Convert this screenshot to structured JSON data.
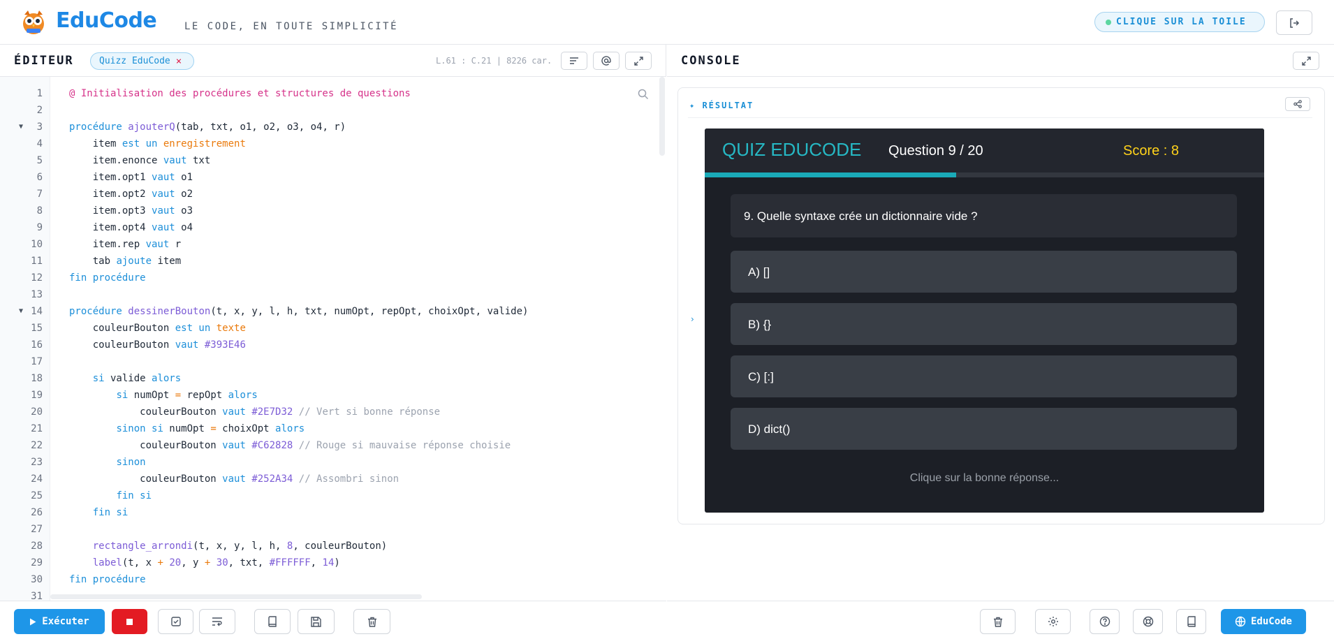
{
  "header": {
    "brand": "EduCode",
    "tagline": "LE CODE, EN TOUTE SIMPLICITÉ",
    "hint": "CLIQUE SUR LA TOILE"
  },
  "editor": {
    "title": "ÉDITEUR",
    "file_tab": "Quizz EduCode",
    "cursor_info": "L.61 : C.21 | 8226 car.",
    "lines": [
      {
        "n": "1",
        "fold": "",
        "html": "<span class=\"dr\">@ Initialisation des procédures et structures de questions</span>"
      },
      {
        "n": "2",
        "fold": "",
        "html": ""
      },
      {
        "n": "3",
        "fold": "▼",
        "html": "<span class=\"kw\">procédure</span> <span class=\"fn\">ajouterQ</span>(tab, txt, o1, o2, o3, o4, r)"
      },
      {
        "n": "4",
        "fold": "",
        "html": "    item <span class=\"kw\">est un</span> <span class=\"ty\">enregistrement</span>"
      },
      {
        "n": "5",
        "fold": "",
        "html": "    item.enonce <span class=\"kw\">vaut</span> txt"
      },
      {
        "n": "6",
        "fold": "",
        "html": "    item.opt1 <span class=\"kw\">vaut</span> o1"
      },
      {
        "n": "7",
        "fold": "",
        "html": "    item.opt2 <span class=\"kw\">vaut</span> o2"
      },
      {
        "n": "8",
        "fold": "",
        "html": "    item.opt3 <span class=\"kw\">vaut</span> o3"
      },
      {
        "n": "9",
        "fold": "",
        "html": "    item.opt4 <span class=\"kw\">vaut</span> o4"
      },
      {
        "n": "10",
        "fold": "",
        "html": "    item.rep <span class=\"kw\">vaut</span> r"
      },
      {
        "n": "11",
        "fold": "",
        "html": "    tab <span class=\"kw\">ajoute</span> item"
      },
      {
        "n": "12",
        "fold": "",
        "html": "<span class=\"kw\">fin procédure</span>"
      },
      {
        "n": "13",
        "fold": "",
        "html": ""
      },
      {
        "n": "14",
        "fold": "▼",
        "html": "<span class=\"kw\">procédure</span> <span class=\"fn\">dessinerBouton</span>(t, x, y, l, h, txt, numOpt, repOpt, choixOpt, valide)"
      },
      {
        "n": "15",
        "fold": "",
        "html": "    couleurBouton <span class=\"kw\">est un</span> <span class=\"ty\">texte</span>"
      },
      {
        "n": "16",
        "fold": "",
        "html": "    couleurBouton <span class=\"kw\">vaut</span> <span class=\"num\">#393E46</span>"
      },
      {
        "n": "17",
        "fold": "",
        "html": ""
      },
      {
        "n": "18",
        "fold": "",
        "html": "    <span class=\"kw\">si</span> valide <span class=\"kw\">alors</span>"
      },
      {
        "n": "19",
        "fold": "",
        "html": "        <span class=\"kw\">si</span> numOpt <span class=\"op\">=</span> repOpt <span class=\"kw\">alors</span>"
      },
      {
        "n": "20",
        "fold": "",
        "html": "            couleurBouton <span class=\"kw\">vaut</span> <span class=\"num\">#2E7D32</span> <span class=\"cm\">// Vert si bonne réponse</span>"
      },
      {
        "n": "21",
        "fold": "",
        "html": "        <span class=\"kw\">sinon si</span> numOpt <span class=\"op\">=</span> choixOpt <span class=\"kw\">alors</span>"
      },
      {
        "n": "22",
        "fold": "",
        "html": "            couleurBouton <span class=\"kw\">vaut</span> <span class=\"num\">#C62828</span> <span class=\"cm\">// Rouge si mauvaise réponse choisie</span>"
      },
      {
        "n": "23",
        "fold": "",
        "html": "        <span class=\"kw\">sinon</span>"
      },
      {
        "n": "24",
        "fold": "",
        "html": "            couleurBouton <span class=\"kw\">vaut</span> <span class=\"num\">#252A34</span> <span class=\"cm\">// Assombri sinon</span>"
      },
      {
        "n": "25",
        "fold": "",
        "html": "        <span class=\"kw\">fin si</span>"
      },
      {
        "n": "26",
        "fold": "",
        "html": "    <span class=\"kw\">fin si</span>"
      },
      {
        "n": "27",
        "fold": "",
        "html": ""
      },
      {
        "n": "28",
        "fold": "",
        "html": "    <span class=\"fn\">rectangle_arrondi</span>(t, x, y, l, h, <span class=\"num\">8</span>, couleurBouton)"
      },
      {
        "n": "29",
        "fold": "",
        "html": "    <span class=\"fn\">label</span>(t, x <span class=\"op\">+</span> <span class=\"num\">20</span>, y <span class=\"op\">+</span> <span class=\"num\">30</span>, txt, <span class=\"num\">#FFFFFF</span>, <span class=\"num\">14</span>)"
      },
      {
        "n": "30",
        "fold": "",
        "html": "<span class=\"kw\">fin procédure</span>"
      },
      {
        "n": "31",
        "fold": "",
        "html": ""
      }
    ],
    "run_label": "Exécuter"
  },
  "console": {
    "title": "CONSOLE",
    "result_label": "✦ RÉSULTAT",
    "quiz": {
      "brand": "QUIZ EDUCODE",
      "counter": "Question 9 / 20",
      "score": "Score : 8",
      "progress": 0.45,
      "question": "9. Quelle syntaxe crée un dictionnaire vide ?",
      "options": [
        "A) []",
        "B) {}",
        "C) [:]",
        "D) dict()"
      ],
      "hint": "Clique sur la bonne réponse..."
    },
    "educode_button": "EduCode"
  },
  "colors": {
    "accent": "#1e96e8",
    "stop": "#e31b23",
    "quiz_teal": "#1aaab8",
    "quiz_score": "#ffd21a"
  }
}
